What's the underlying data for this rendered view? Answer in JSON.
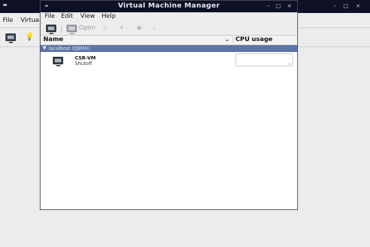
{
  "background_window": {
    "menu": [
      "File",
      "Virtua"
    ],
    "title_controls": "– □ ×"
  },
  "window": {
    "title": "Virtual Machine Manager",
    "controls": {
      "minimize": "–",
      "maximize": "□",
      "close": "×"
    }
  },
  "menubar": {
    "file": "File",
    "edit": "Edit",
    "view": "View",
    "help": "Help"
  },
  "toolbar": {
    "open_label": "Open",
    "icons": [
      "new-vm-icon",
      "open-icon",
      "play-icon",
      "pause-icon",
      "power-icon",
      "chevron-down-icon"
    ]
  },
  "list": {
    "columns": {
      "name": "Name",
      "cpu": "CPU usage"
    },
    "connection": "localhost (QEMU)",
    "vms": [
      {
        "name": "CSR-VM",
        "state": "Shutoff"
      }
    ]
  },
  "colors": {
    "titlebar": "#0e1126",
    "selection": "#5b75a8",
    "background": "#ededed"
  }
}
